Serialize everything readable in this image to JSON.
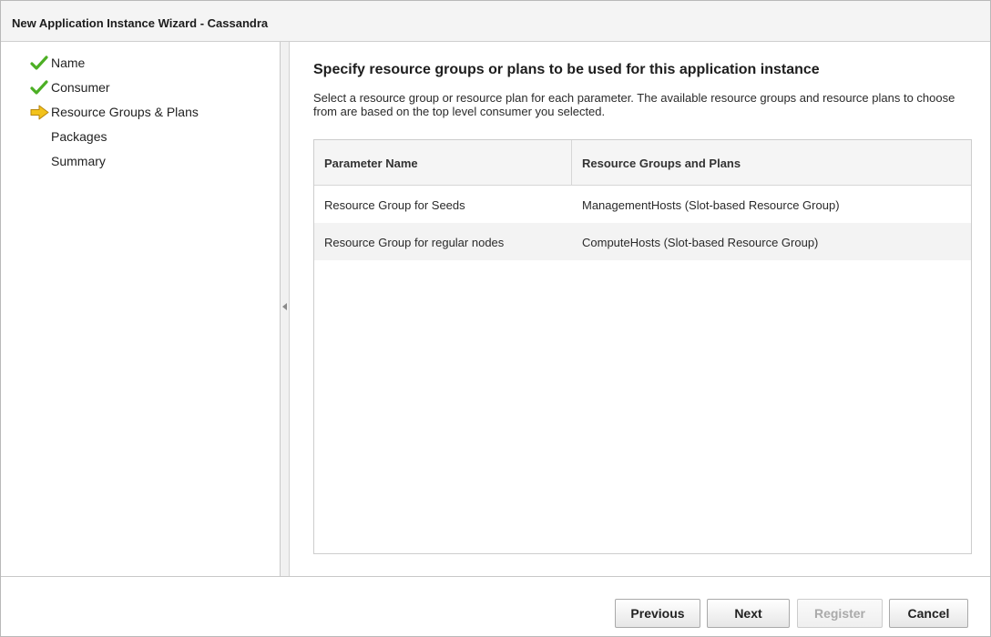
{
  "window": {
    "title": "New Application Instance Wizard - Cassandra"
  },
  "sidebar": {
    "steps": [
      {
        "label": "Name",
        "state": "completed",
        "icon": "checkmark-icon"
      },
      {
        "label": "Consumer",
        "state": "completed",
        "icon": "checkmark-icon"
      },
      {
        "label": "Resource Groups & Plans",
        "state": "current",
        "icon": "arrow-right-icon"
      },
      {
        "label": "Packages",
        "state": "pending",
        "icon": ""
      },
      {
        "label": "Summary",
        "state": "pending",
        "icon": ""
      }
    ]
  },
  "main": {
    "heading": "Specify resource groups or plans to be used for this application instance",
    "description": "Select a resource group or resource plan for each parameter. The available resource groups and resource plans to choose from are based on the top level consumer you selected.",
    "table": {
      "columns": [
        "Parameter Name",
        "Resource Groups and Plans"
      ],
      "rows": [
        [
          "Resource Group for Seeds",
          "ManagementHosts (Slot-based Resource Group)"
        ],
        [
          "Resource Group for regular nodes",
          "ComputeHosts (Slot-based Resource Group)"
        ]
      ]
    }
  },
  "footer": {
    "previous_label": "Previous",
    "next_label": "Next",
    "register_label": "Register",
    "cancel_label": "Cancel"
  },
  "colors": {
    "check": "#4caf24",
    "arrow": "#f2c21b",
    "arrow_stroke": "#b8860b"
  }
}
